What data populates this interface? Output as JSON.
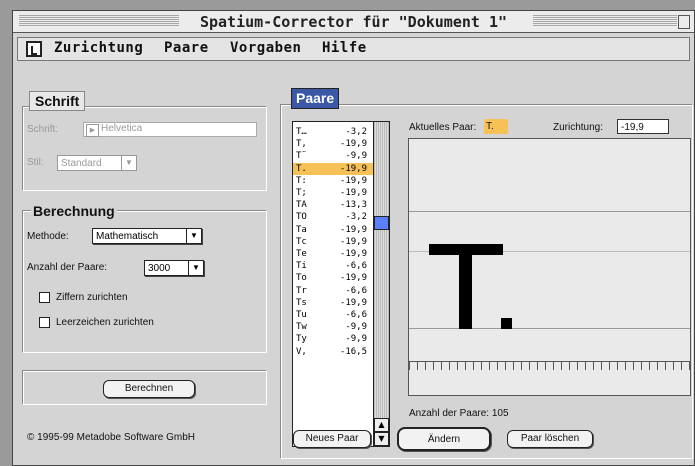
{
  "window": {
    "title": "Spatium-Corrector für \"Dokument 1\""
  },
  "menubar": {
    "items": [
      "Zurichtung",
      "Paare",
      "Vorgaben",
      "Hilfe"
    ]
  },
  "schrift": {
    "header": "Schrift",
    "font_label": "Schrift:",
    "font_value": "Helvetica",
    "style_label": "Stil:",
    "style_value": "Standard"
  },
  "berechnung": {
    "header": "Berechnung",
    "method_label": "Methode:",
    "method_value": "Mathematisch",
    "pairs_label": "Anzahl der Paare:",
    "pairs_value": "3000",
    "checkbox_digits": "Ziffern zurichten",
    "checkbox_spaces": "Leerzeichen zurichten",
    "checkbox_digits_checked": false,
    "checkbox_spaces_checked": false
  },
  "compute_button": "Berechnen",
  "copyright": "© 1995-99 Metadobe Software GmbH",
  "paare": {
    "tab": "Paare",
    "current_pair_label": "Aktuelles Paar:",
    "current_pair_value": "T.",
    "zurichtung_label": "Zurichtung:",
    "zurichtung_value": "-19,9",
    "pair_count": "Anzahl der Paare: 105",
    "selected_index": 3,
    "pairs": [
      {
        "chars": "T…",
        "value": "-3,2"
      },
      {
        "chars": "T,",
        "value": "-19,9"
      },
      {
        "chars": "T¨",
        "value": "-9,9"
      },
      {
        "chars": "T.",
        "value": "-19,9"
      },
      {
        "chars": "T:",
        "value": "-19,9"
      },
      {
        "chars": "T;",
        "value": "-19,9"
      },
      {
        "chars": "TA",
        "value": "-13,3"
      },
      {
        "chars": "TO",
        "value": "-3,2"
      },
      {
        "chars": "Ta",
        "value": "-19,9"
      },
      {
        "chars": "Tc",
        "value": "-19,9"
      },
      {
        "chars": "Te",
        "value": "-19,9"
      },
      {
        "chars": "Ti",
        "value": "-6,6"
      },
      {
        "chars": "To",
        "value": "-19,9"
      },
      {
        "chars": "Tr",
        "value": "-6,6"
      },
      {
        "chars": "Ts",
        "value": "-19,9"
      },
      {
        "chars": "Tu",
        "value": "-6,6"
      },
      {
        "chars": "Tw",
        "value": "-9,9"
      },
      {
        "chars": "Ty",
        "value": "-9,9"
      },
      {
        "chars": "V,",
        "value": "-16,5"
      }
    ],
    "buttons": {
      "new": "Neues Paar",
      "change": "Ändern",
      "delete": "Paar löschen"
    }
  },
  "colors": {
    "selection": "#f6c257",
    "tab": "#3a58a6",
    "scroll_thumb": "#5b7fff"
  }
}
